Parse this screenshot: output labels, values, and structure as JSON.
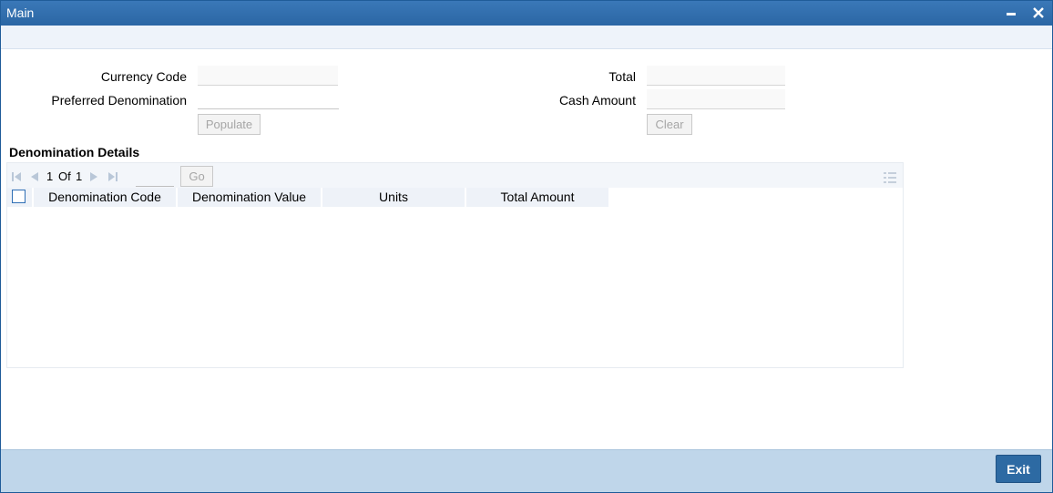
{
  "window": {
    "title": "Main"
  },
  "form": {
    "currency_code": {
      "label": "Currency Code",
      "value": ""
    },
    "preferred_denomination": {
      "label": "Preferred Denomination",
      "value": ""
    },
    "total": {
      "label": "Total",
      "value": ""
    },
    "cash_amount": {
      "label": "Cash Amount",
      "value": ""
    },
    "populate_label": "Populate",
    "clear_label": "Clear"
  },
  "denomination": {
    "section_title": "Denomination Details",
    "pager": {
      "current": "1",
      "of_label": "Of",
      "total": "1",
      "go_label": "Go"
    },
    "columns": [
      "Denomination Code",
      "Denomination Value",
      "Units",
      "Total Amount"
    ],
    "rows": []
  },
  "footer": {
    "exit_label": "Exit"
  },
  "colors": {
    "titlebar": "#2b66a4",
    "footer": "#bfd6ea",
    "exit_button": "#2d6aa3"
  }
}
